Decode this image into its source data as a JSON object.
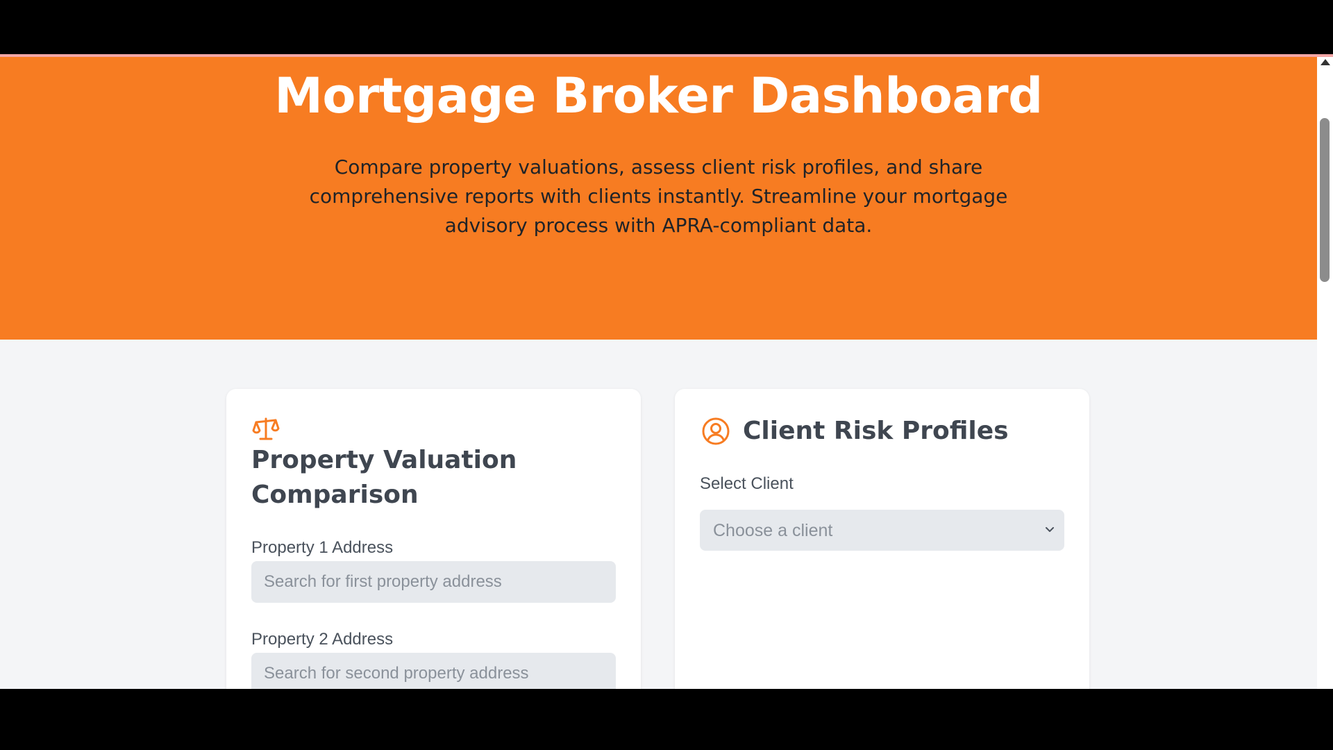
{
  "hero": {
    "title": "Mortgage Broker Dashboard",
    "subtitle": "Compare property valuations, assess client risk profiles, and share comprehensive reports with clients instantly. Streamline your mortgage advisory process with APRA-compliant data."
  },
  "valuation_card": {
    "icon": "scale-icon",
    "title": "Property Valuation Comparison",
    "property1_label": "Property 1 Address",
    "property1_placeholder": "Search for first property address",
    "property2_label": "Property 2 Address",
    "property2_placeholder": "Search for second property address"
  },
  "risk_card": {
    "icon": "user-circle-icon",
    "title": "Client Risk Profiles",
    "select_label": "Select Client",
    "select_value": "Choose a client"
  },
  "colors": {
    "accent": "#f77c22",
    "page_background": "#f4f5f7",
    "input_background": "#e6e9ed"
  }
}
